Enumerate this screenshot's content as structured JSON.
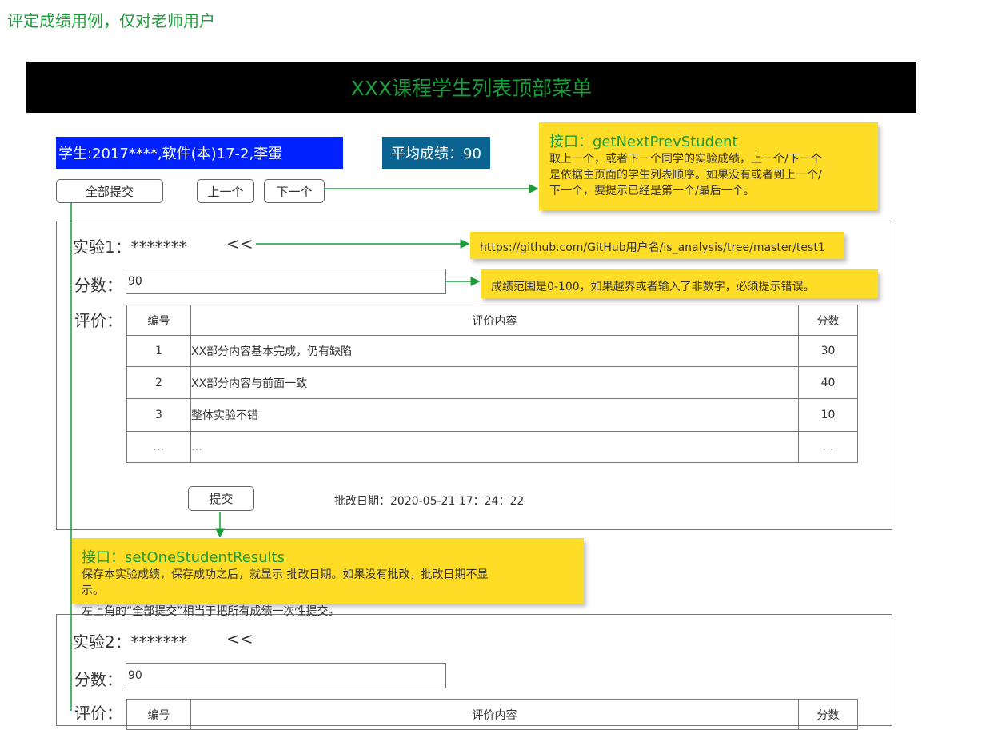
{
  "page": {
    "title": "评定成绩用例，仅对老师用户"
  },
  "header": {
    "menu_title": "XXX课程学生列表顶部菜单"
  },
  "student": {
    "info": "学生:2017****,软件(本)17-2,李蛋",
    "avg": "平均成绩：90"
  },
  "nav": {
    "submit_all": "全部提交",
    "prev": "上一个",
    "next": "下一个"
  },
  "notes": {
    "nav_api": {
      "title": "接口：getNextPrevStudent",
      "line1": "取上一个，或者下一个同学的实验成绩，上一个/下一个",
      "line2": "是依据主页面的学生列表顺序。如果没有或者到上一个/",
      "line3": "下一个，要提示已经是第一个/最后一个。"
    },
    "github": "https://github.com/GitHub用户名/is_analysis/tree/master/test1",
    "score_range": "成绩范围是0-100，如果越界或者输入了非数字，必须提示错误。",
    "save_api": {
      "title": "接口：setOneStudentResults",
      "line1": "保存本实验成绩，保存成功之后，就显示 批改日期。如果没有批改，批改日期不显",
      "line2": "示。",
      "line3": "左上角的“全部提交”相当于把所有成绩一次性提交。"
    }
  },
  "exp1": {
    "title": "实验1：*******",
    "link": "<<",
    "score_label": "分数：",
    "score_value": "90",
    "eval_label": "评价：",
    "table": {
      "headers": [
        "编号",
        "评价内容",
        "分数"
      ],
      "rows": [
        [
          "1",
          "XX部分内容基本完成，仍有缺陷",
          "30"
        ],
        [
          "2",
          "XX部分内容与前面一致",
          "40"
        ],
        [
          "3",
          "整体实验不错",
          "10"
        ],
        [
          "…",
          "…",
          "…"
        ]
      ]
    },
    "submit": "提交",
    "date": "批改日期：2020-05-21 17：24：22"
  },
  "exp2": {
    "title": "实验2：*******",
    "link": "<<",
    "score_label": "分数：",
    "score_value": "90",
    "eval_label": "评价：",
    "table": {
      "headers": [
        "编号",
        "评价内容",
        "分数"
      ]
    }
  }
}
